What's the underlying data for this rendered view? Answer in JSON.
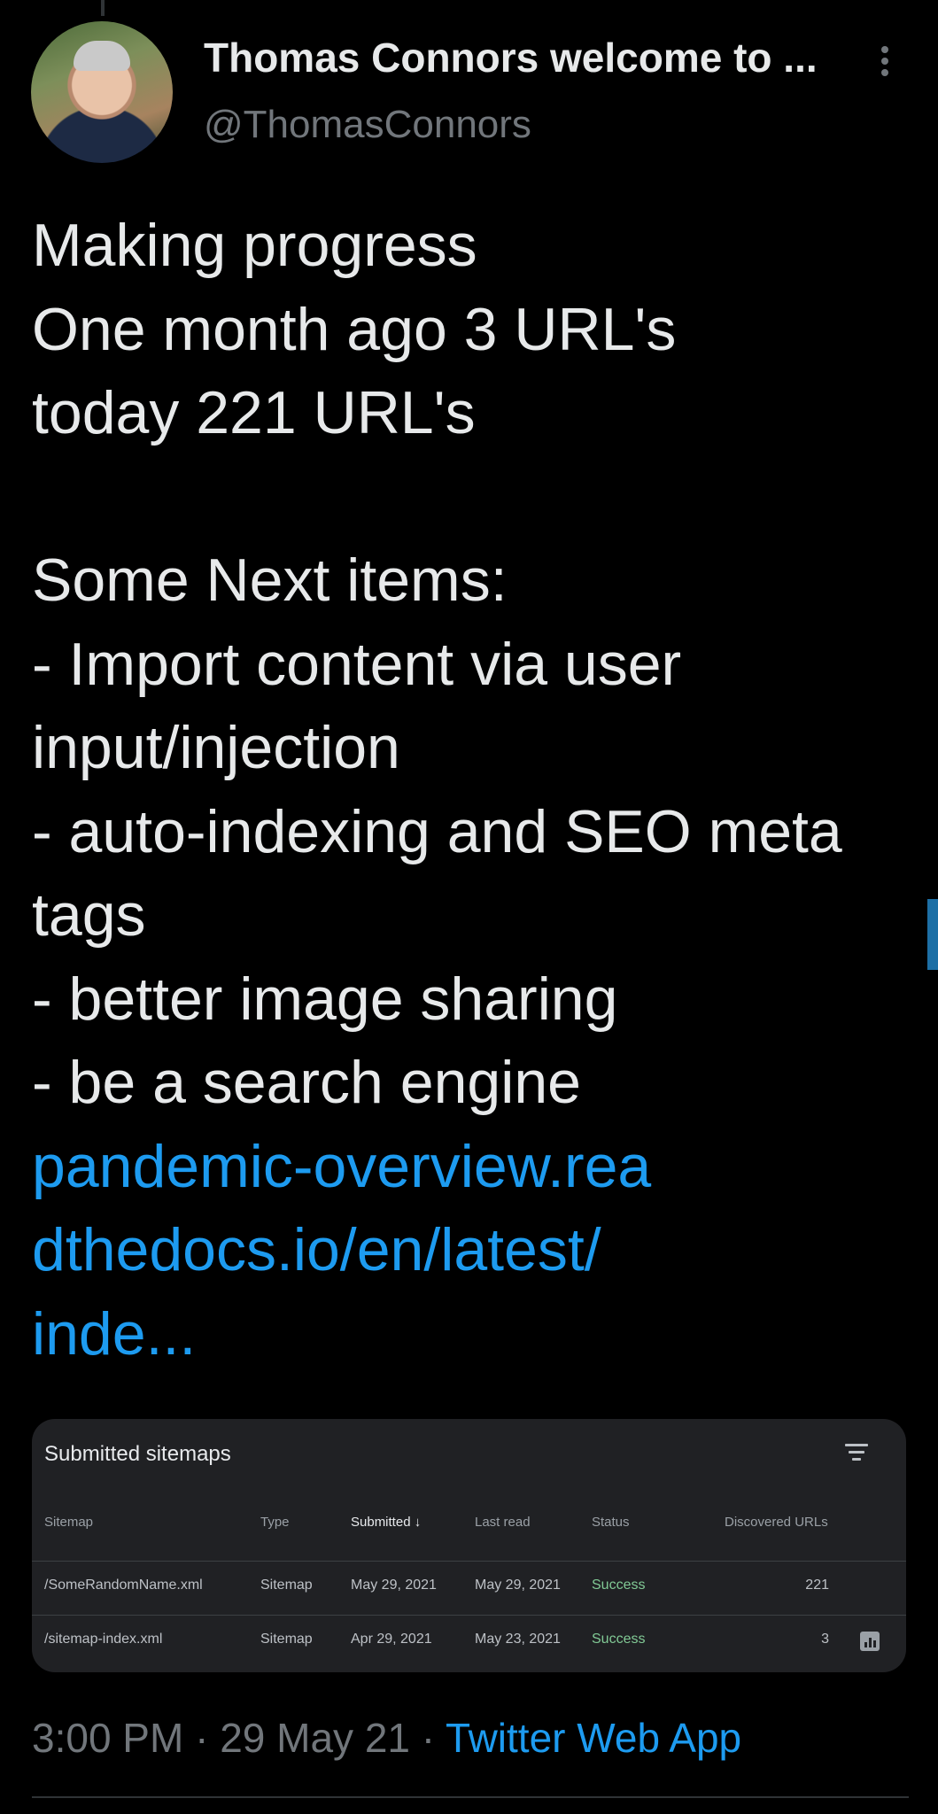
{
  "tweet": {
    "display_name": "Thomas Connors welcome to ...",
    "handle": "@ThomasConnors",
    "lines": [
      "Making progress",
      "One month ago 3 URL's",
      "today 221 URL's",
      "",
      "Some Next items:",
      "- Import content via user",
      "input/injection",
      "- auto-indexing and SEO meta",
      "tags",
      "- better image sharing",
      "- be a search engine"
    ],
    "link_lines": [
      "pandemic-overview.rea",
      "dthedocs.io/en/latest/",
      "inde..."
    ],
    "timestamp": "3:00 PM · 29 May 21 · ",
    "source": "Twitter Web App"
  },
  "sitemaps_card": {
    "title": "Submitted sitemaps",
    "headers": {
      "sitemap": "Sitemap",
      "type": "Type",
      "submitted": "Submitted ↓",
      "last_read": "Last read",
      "status": "Status",
      "discovered": "Discovered URLs"
    },
    "rows": [
      {
        "sitemap": "/SomeRandomName.xml",
        "type": "Sitemap",
        "submitted": "May 29, 2021",
        "last_read": "May 29, 2021",
        "status": "Success",
        "discovered": "221"
      },
      {
        "sitemap": "/sitemap-index.xml",
        "type": "Sitemap",
        "submitted": "Apr 29, 2021",
        "last_read": "May 23, 2021",
        "status": "Success",
        "discovered": "3"
      }
    ]
  },
  "icons": {
    "more": "more-vertical-icon",
    "filter": "filter-icon",
    "chart": "bar-chart-icon"
  },
  "colors": {
    "background": "#000000",
    "link": "#1d9bf0",
    "success": "#81c995",
    "card": "#202124"
  }
}
